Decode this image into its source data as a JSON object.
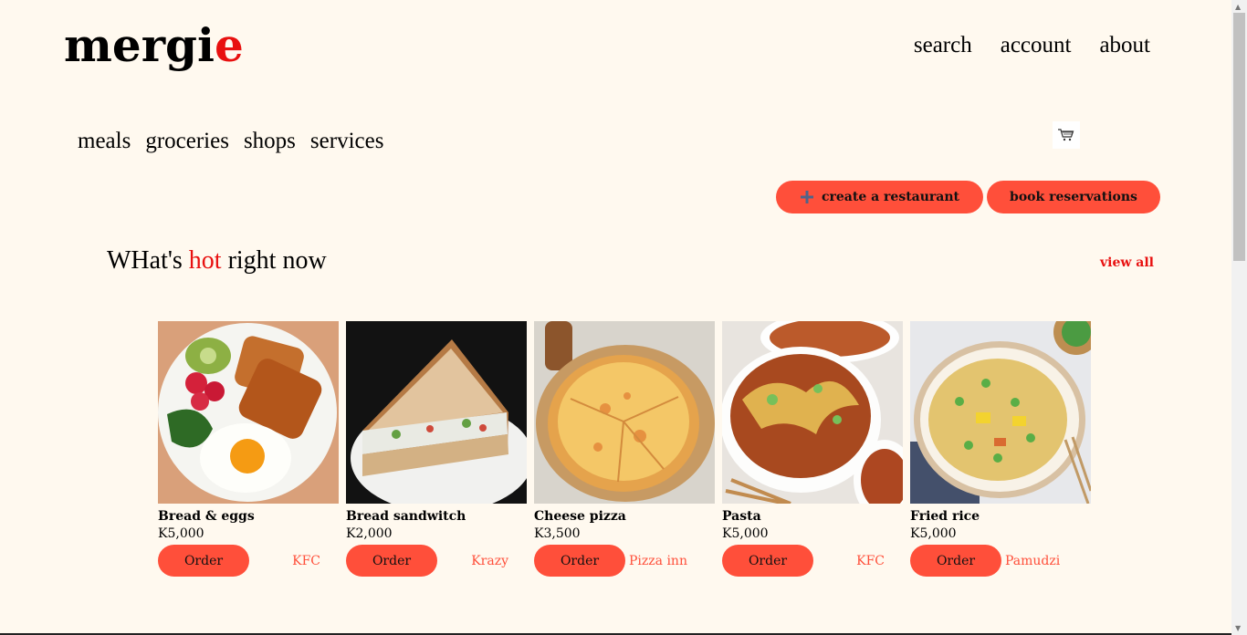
{
  "brand": {
    "name_prefix": "mergi",
    "name_suffix": "e",
    "accent": "#e8100f"
  },
  "top_nav": [
    "search",
    "account",
    "about"
  ],
  "sub_nav": [
    "meals",
    "groceries",
    "shops",
    "services"
  ],
  "icons": {
    "cart": "shopping-cart-icon",
    "plus": "plus-icon"
  },
  "actions": {
    "create_restaurant": "create a restaurant",
    "book_reservations": "book reservations"
  },
  "hot_section": {
    "title_before": "WHat's ",
    "title_hot": "hot",
    "title_after": " right now",
    "view_all": "view all"
  },
  "items": [
    {
      "name": "Bread & eggs",
      "price": "K5,000",
      "order": "Order",
      "store": "KFC"
    },
    {
      "name": "Bread sandwitch",
      "price": "K2,000",
      "order": "Order",
      "store": "Krazy"
    },
    {
      "name": "Cheese pizza",
      "price": "K3,500",
      "order": "Order",
      "store": "Pizza inn"
    },
    {
      "name": "Pasta",
      "price": "K5,000",
      "order": "Order",
      "store": "KFC"
    },
    {
      "name": "Fried rice",
      "price": "K5,000",
      "order": "Order",
      "store": "Pamudzi"
    }
  ],
  "colors": {
    "background": "#fff9ef",
    "button": "#ff4f3a"
  }
}
